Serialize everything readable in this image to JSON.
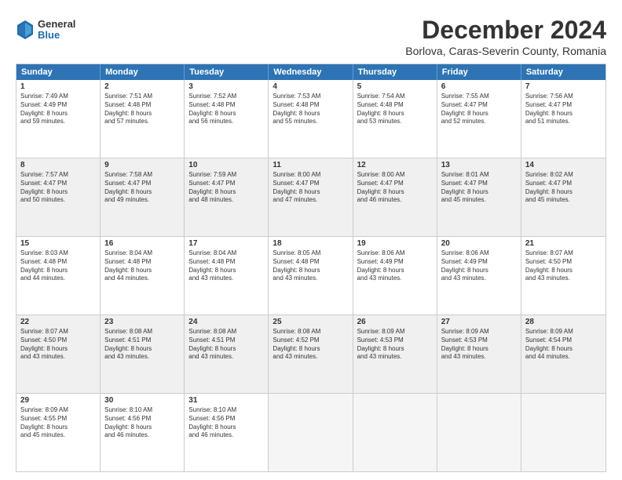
{
  "header": {
    "logo_general": "General",
    "logo_blue": "Blue",
    "title": "December 2024",
    "subtitle": "Borlova, Caras-Severin County, Romania"
  },
  "weekdays": [
    "Sunday",
    "Monday",
    "Tuesday",
    "Wednesday",
    "Thursday",
    "Friday",
    "Saturday"
  ],
  "rows": [
    [
      {
        "day": "1",
        "lines": [
          "Sunrise: 7:49 AM",
          "Sunset: 4:49 PM",
          "Daylight: 8 hours",
          "and 59 minutes."
        ]
      },
      {
        "day": "2",
        "lines": [
          "Sunrise: 7:51 AM",
          "Sunset: 4:48 PM",
          "Daylight: 8 hours",
          "and 57 minutes."
        ]
      },
      {
        "day": "3",
        "lines": [
          "Sunrise: 7:52 AM",
          "Sunset: 4:48 PM",
          "Daylight: 8 hours",
          "and 56 minutes."
        ]
      },
      {
        "day": "4",
        "lines": [
          "Sunrise: 7:53 AM",
          "Sunset: 4:48 PM",
          "Daylight: 8 hours",
          "and 55 minutes."
        ]
      },
      {
        "day": "5",
        "lines": [
          "Sunrise: 7:54 AM",
          "Sunset: 4:48 PM",
          "Daylight: 8 hours",
          "and 53 minutes."
        ]
      },
      {
        "day": "6",
        "lines": [
          "Sunrise: 7:55 AM",
          "Sunset: 4:47 PM",
          "Daylight: 8 hours",
          "and 52 minutes."
        ]
      },
      {
        "day": "7",
        "lines": [
          "Sunrise: 7:56 AM",
          "Sunset: 4:47 PM",
          "Daylight: 8 hours",
          "and 51 minutes."
        ]
      }
    ],
    [
      {
        "day": "8",
        "lines": [
          "Sunrise: 7:57 AM",
          "Sunset: 4:47 PM",
          "Daylight: 8 hours",
          "and 50 minutes."
        ]
      },
      {
        "day": "9",
        "lines": [
          "Sunrise: 7:58 AM",
          "Sunset: 4:47 PM",
          "Daylight: 8 hours",
          "and 49 minutes."
        ]
      },
      {
        "day": "10",
        "lines": [
          "Sunrise: 7:59 AM",
          "Sunset: 4:47 PM",
          "Daylight: 8 hours",
          "and 48 minutes."
        ]
      },
      {
        "day": "11",
        "lines": [
          "Sunrise: 8:00 AM",
          "Sunset: 4:47 PM",
          "Daylight: 8 hours",
          "and 47 minutes."
        ]
      },
      {
        "day": "12",
        "lines": [
          "Sunrise: 8:00 AM",
          "Sunset: 4:47 PM",
          "Daylight: 8 hours",
          "and 46 minutes."
        ]
      },
      {
        "day": "13",
        "lines": [
          "Sunrise: 8:01 AM",
          "Sunset: 4:47 PM",
          "Daylight: 8 hours",
          "and 45 minutes."
        ]
      },
      {
        "day": "14",
        "lines": [
          "Sunrise: 8:02 AM",
          "Sunset: 4:47 PM",
          "Daylight: 8 hours",
          "and 45 minutes."
        ]
      }
    ],
    [
      {
        "day": "15",
        "lines": [
          "Sunrise: 8:03 AM",
          "Sunset: 4:48 PM",
          "Daylight: 8 hours",
          "and 44 minutes."
        ]
      },
      {
        "day": "16",
        "lines": [
          "Sunrise: 8:04 AM",
          "Sunset: 4:48 PM",
          "Daylight: 8 hours",
          "and 44 minutes."
        ]
      },
      {
        "day": "17",
        "lines": [
          "Sunrise: 8:04 AM",
          "Sunset: 4:48 PM",
          "Daylight: 8 hours",
          "and 43 minutes."
        ]
      },
      {
        "day": "18",
        "lines": [
          "Sunrise: 8:05 AM",
          "Sunset: 4:48 PM",
          "Daylight: 8 hours",
          "and 43 minutes."
        ]
      },
      {
        "day": "19",
        "lines": [
          "Sunrise: 8:06 AM",
          "Sunset: 4:49 PM",
          "Daylight: 8 hours",
          "and 43 minutes."
        ]
      },
      {
        "day": "20",
        "lines": [
          "Sunrise: 8:06 AM",
          "Sunset: 4:49 PM",
          "Daylight: 8 hours",
          "and 43 minutes."
        ]
      },
      {
        "day": "21",
        "lines": [
          "Sunrise: 8:07 AM",
          "Sunset: 4:50 PM",
          "Daylight: 8 hours",
          "and 43 minutes."
        ]
      }
    ],
    [
      {
        "day": "22",
        "lines": [
          "Sunrise: 8:07 AM",
          "Sunset: 4:50 PM",
          "Daylight: 8 hours",
          "and 43 minutes."
        ]
      },
      {
        "day": "23",
        "lines": [
          "Sunrise: 8:08 AM",
          "Sunset: 4:51 PM",
          "Daylight: 8 hours",
          "and 43 minutes."
        ]
      },
      {
        "day": "24",
        "lines": [
          "Sunrise: 8:08 AM",
          "Sunset: 4:51 PM",
          "Daylight: 8 hours",
          "and 43 minutes."
        ]
      },
      {
        "day": "25",
        "lines": [
          "Sunrise: 8:08 AM",
          "Sunset: 4:52 PM",
          "Daylight: 8 hours",
          "and 43 minutes."
        ]
      },
      {
        "day": "26",
        "lines": [
          "Sunrise: 8:09 AM",
          "Sunset: 4:53 PM",
          "Daylight: 8 hours",
          "and 43 minutes."
        ]
      },
      {
        "day": "27",
        "lines": [
          "Sunrise: 8:09 AM",
          "Sunset: 4:53 PM",
          "Daylight: 8 hours",
          "and 43 minutes."
        ]
      },
      {
        "day": "28",
        "lines": [
          "Sunrise: 8:09 AM",
          "Sunset: 4:54 PM",
          "Daylight: 8 hours",
          "and 44 minutes."
        ]
      }
    ],
    [
      {
        "day": "29",
        "lines": [
          "Sunrise: 8:09 AM",
          "Sunset: 4:55 PM",
          "Daylight: 8 hours",
          "and 45 minutes."
        ]
      },
      {
        "day": "30",
        "lines": [
          "Sunrise: 8:10 AM",
          "Sunset: 4:56 PM",
          "Daylight: 8 hours",
          "and 46 minutes."
        ]
      },
      {
        "day": "31",
        "lines": [
          "Sunrise: 8:10 AM",
          "Sunset: 4:56 PM",
          "Daylight: 8 hours",
          "and 46 minutes."
        ]
      },
      {
        "day": "",
        "lines": []
      },
      {
        "day": "",
        "lines": []
      },
      {
        "day": "",
        "lines": []
      },
      {
        "day": "",
        "lines": []
      }
    ]
  ]
}
